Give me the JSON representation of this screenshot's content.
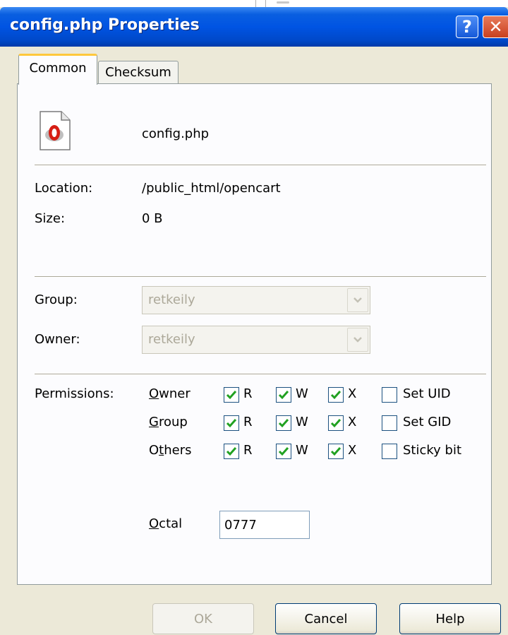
{
  "window": {
    "title": "config.php Properties"
  },
  "tabs": [
    {
      "label": "Common"
    },
    {
      "label": "Checksum"
    }
  ],
  "file": {
    "name": "config.php",
    "icon": "php-file-icon"
  },
  "info": {
    "location_label": "Location:",
    "location_value": "/public_html/opencart",
    "size_label": "Size:",
    "size_value": "0 B"
  },
  "ownership": {
    "group_label": "Group:",
    "group_value": "retkeily",
    "owner_label": "Owner:",
    "owner_value": "retkeily"
  },
  "permissions": {
    "label": "Permissions:",
    "rows": [
      {
        "name": "Owner",
        "r": true,
        "w": true,
        "x": true,
        "special": "Set UID",
        "special_checked": false
      },
      {
        "name": "Group",
        "r": true,
        "w": true,
        "x": true,
        "special": "Set GID",
        "special_checked": false
      },
      {
        "name": "Others",
        "r": true,
        "w": true,
        "x": true,
        "special": "Sticky bit",
        "special_checked": false
      }
    ],
    "r_label": "R",
    "w_label": "W",
    "x_label": "X",
    "octal_label": "Octal",
    "octal_value": "0777"
  },
  "buttons": {
    "ok": "OK",
    "cancel": "Cancel",
    "help": "Help"
  },
  "colors": {
    "title_bar": "#0054e3",
    "face": "#ece9d8",
    "check": "#21a121",
    "tab_highlight": "#ffc83c"
  }
}
